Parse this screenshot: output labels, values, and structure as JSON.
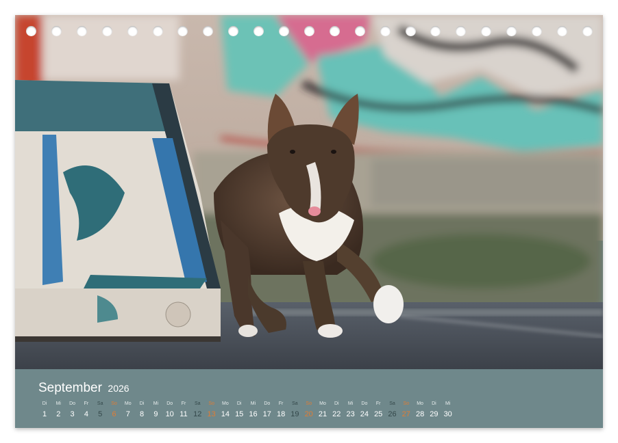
{
  "calendar": {
    "month": "September",
    "year": "2026",
    "photo_subject": "brindle bull terrier running on asphalt in front of graffiti wall",
    "days": [
      {
        "dow": "Di",
        "num": "1"
      },
      {
        "dow": "Mi",
        "num": "2"
      },
      {
        "dow": "Do",
        "num": "3"
      },
      {
        "dow": "Fr",
        "num": "4"
      },
      {
        "dow": "Sa",
        "num": "5",
        "type": "sat"
      },
      {
        "dow": "So",
        "num": "6",
        "type": "sun"
      },
      {
        "dow": "Mo",
        "num": "7"
      },
      {
        "dow": "Di",
        "num": "8"
      },
      {
        "dow": "Mi",
        "num": "9"
      },
      {
        "dow": "Do",
        "num": "10"
      },
      {
        "dow": "Fr",
        "num": "11"
      },
      {
        "dow": "Sa",
        "num": "12",
        "type": "sat"
      },
      {
        "dow": "So",
        "num": "13",
        "type": "sun"
      },
      {
        "dow": "Mo",
        "num": "14"
      },
      {
        "dow": "Di",
        "num": "15"
      },
      {
        "dow": "Mi",
        "num": "16"
      },
      {
        "dow": "Do",
        "num": "17"
      },
      {
        "dow": "Fr",
        "num": "18"
      },
      {
        "dow": "Sa",
        "num": "19",
        "type": "sat"
      },
      {
        "dow": "So",
        "num": "20",
        "type": "sun"
      },
      {
        "dow": "Mo",
        "num": "21"
      },
      {
        "dow": "Di",
        "num": "22"
      },
      {
        "dow": "Mi",
        "num": "23"
      },
      {
        "dow": "Do",
        "num": "24"
      },
      {
        "dow": "Fr",
        "num": "25"
      },
      {
        "dow": "Sa",
        "num": "26",
        "type": "sat"
      },
      {
        "dow": "So",
        "num": "27",
        "type": "sun"
      },
      {
        "dow": "Mo",
        "num": "28"
      },
      {
        "dow": "Di",
        "num": "29"
      },
      {
        "dow": "Mi",
        "num": "30"
      }
    ]
  },
  "colors": {
    "strip": "#6f888b",
    "weekday_text": "#ffffff",
    "saturday_text": "#34484a",
    "sunday_text": "#e07d34"
  }
}
